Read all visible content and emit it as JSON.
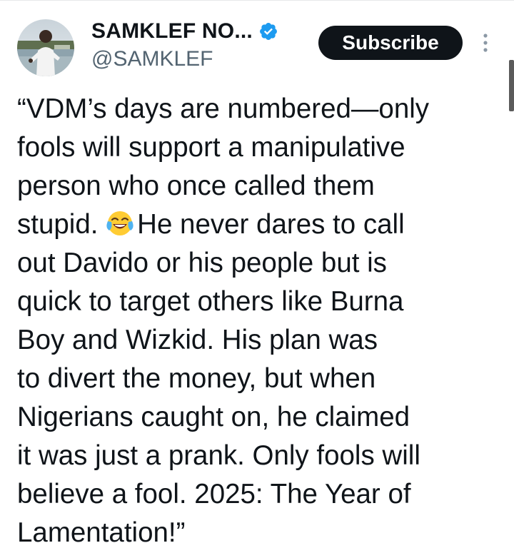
{
  "account": {
    "display_name": "SAMKLEF NO...",
    "handle": "@SAMKLEF",
    "verified": true,
    "verified_color": "#1d9bf0"
  },
  "actions": {
    "subscribe_label": "Subscribe"
  },
  "tweet": {
    "lines": [
      "“VDM’s days are numbered—only",
      "fools will support a manipulative",
      "person who once called them",
      "stupid.",
      "He never dares to call",
      "out Davido or his people but is",
      "quick to target others like Burna",
      "Boy and Wizkid. His plan was",
      "to divert the money, but when",
      "Nigerians caught on, he claimed",
      "it was just a prank. Only fools will",
      "believe a fool. 2025: The Year of",
      "Lamentation!”"
    ],
    "emoji": "face-with-tears-of-joy-icon"
  },
  "colors": {
    "text": "#0f1419",
    "secondary_text": "#536471",
    "button_bg": "#0f1419",
    "button_text": "#ffffff"
  }
}
